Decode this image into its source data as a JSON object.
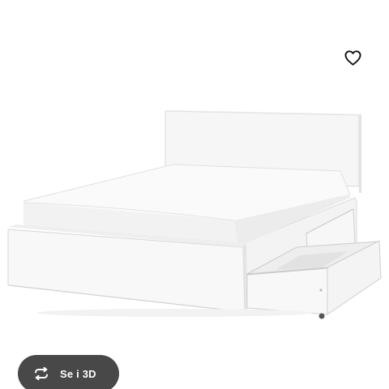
{
  "product": {
    "image_alt": "Seng",
    "image_subject": "white-bed-with-storage-drawers"
  },
  "favorite": {
    "icon": "heart-outline-icon"
  },
  "view_3d": {
    "label": "Se i 3D",
    "icon": "rotate-3d-icon",
    "background_color": "#484848"
  }
}
